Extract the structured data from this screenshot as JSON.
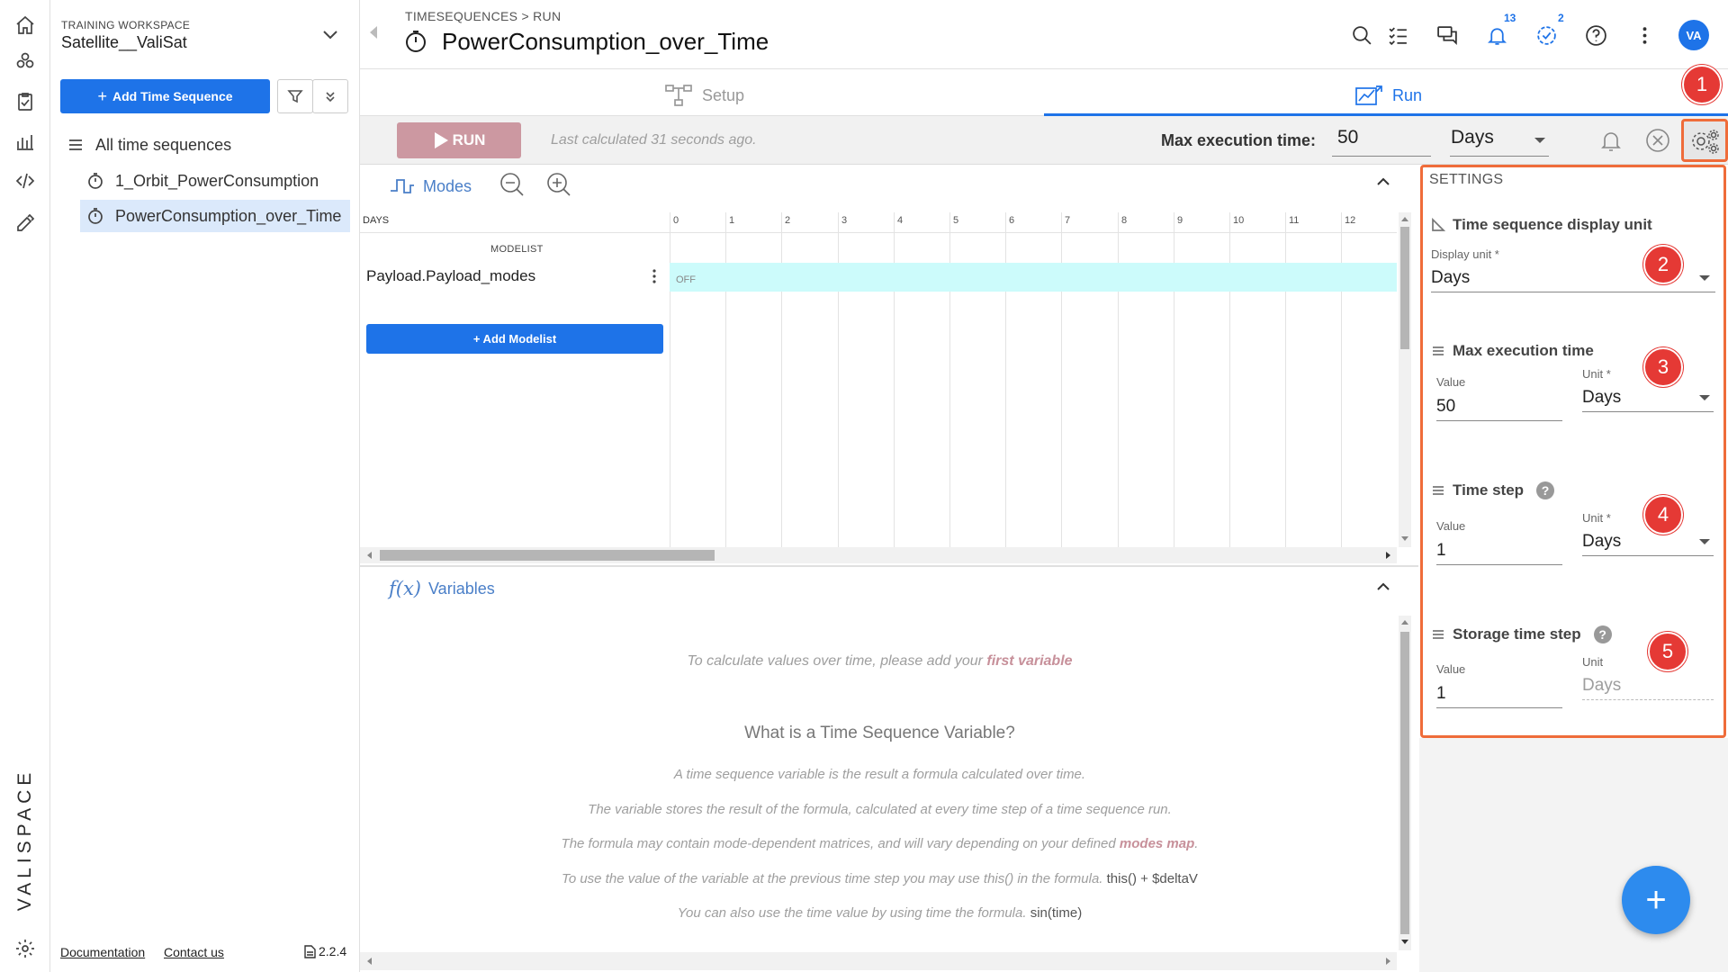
{
  "app": {
    "brand": "VALISPACE"
  },
  "rail": {
    "icons": [
      "home-icon",
      "components-icon",
      "requirements-icon",
      "analytics-icon",
      "code-icon",
      "tools-icon",
      "settings-icon"
    ]
  },
  "sidebar": {
    "workspace_label": "TRAINING WORKSPACE",
    "workspace_name": "Satellite__ValiSat",
    "add_button": "Add Time Sequence",
    "add_button_icon": "+",
    "tree": [
      {
        "label": "All time sequences"
      },
      {
        "label": "1_Orbit_PowerConsumption"
      },
      {
        "label": "PowerConsumption_over_Time",
        "selected": true
      }
    ],
    "footer": {
      "documentation": "Documentation",
      "contact": "Contact us",
      "version": "2.2.4"
    }
  },
  "header": {
    "breadcrumb": [
      "TIMESEQUENCES",
      "RUN"
    ],
    "title": "PowerConsumption_over_Time",
    "notifications_count": "13",
    "tasks_count": "2",
    "avatar": "VA"
  },
  "tabs": [
    {
      "label": "Setup",
      "active": false
    },
    {
      "label": "Run",
      "active": true
    }
  ],
  "toolbar": {
    "run_button": "RUN",
    "last_calculated": "Last calculated 31 seconds ago.",
    "max_exec_label": "Max execution time:",
    "max_exec_value": "50",
    "max_exec_unit": "Days"
  },
  "modes": {
    "header": "Modes",
    "axis_label": "DAYS",
    "ticks": [
      "0",
      "1",
      "2",
      "3",
      "4",
      "5",
      "6",
      "7",
      "8",
      "9",
      "10",
      "11",
      "12"
    ],
    "modelist_label": "MODELIST",
    "rows": [
      {
        "name": "Payload.Payload_modes",
        "state": "OFF"
      }
    ],
    "add_modelist": "+ Add Modelist"
  },
  "variables": {
    "header": "Variables",
    "fx": "f(x)",
    "empty_prefix": "To calculate values over time, please add your ",
    "empty_link": "first variable",
    "question": "What is a Time Sequence Variable?",
    "line1": "A time sequence variable is the result a formula calculated over time.",
    "line2": "The variable stores the result of the formula, calculated at every time step of a time sequence run.",
    "line3_prefix": "The formula may contain mode-dependent matrices, and will vary depending on your defined ",
    "line3_link": "modes map",
    "line3_suffix": ".",
    "line4_prefix": "To use the value of the variable at the previous time step you may use this() in the formula. ",
    "line4_code": "this() + $deltaV",
    "line5_prefix": "You can also use the time value by using time the formula. ",
    "line5_code": "sin(time)"
  },
  "settings": {
    "title": "SETTINGS",
    "display_unit": {
      "title": "Time sequence display unit",
      "label": "Display unit *",
      "value": "Days"
    },
    "max_exec": {
      "title": "Max execution time",
      "value_label": "Value",
      "value": "50",
      "unit_label": "Unit *",
      "unit": "Days"
    },
    "time_step": {
      "title": "Time step",
      "help": "?",
      "value_label": "Value",
      "value": "1",
      "unit_label": "Unit *",
      "unit": "Days"
    },
    "storage_step": {
      "title": "Storage time step",
      "help": "?",
      "value_label": "Value",
      "value": "1",
      "unit_label": "Unit",
      "unit": "Days"
    }
  },
  "annotations": [
    "1",
    "2",
    "3",
    "4",
    "5"
  ],
  "fab": "+",
  "colors": {
    "accent": "#1e73e8",
    "annotation_box": "#ef6c3a",
    "annotation_marker": "#e53935",
    "run_disabled": "#cc98a1",
    "mode_off": "#ccfbfb"
  }
}
